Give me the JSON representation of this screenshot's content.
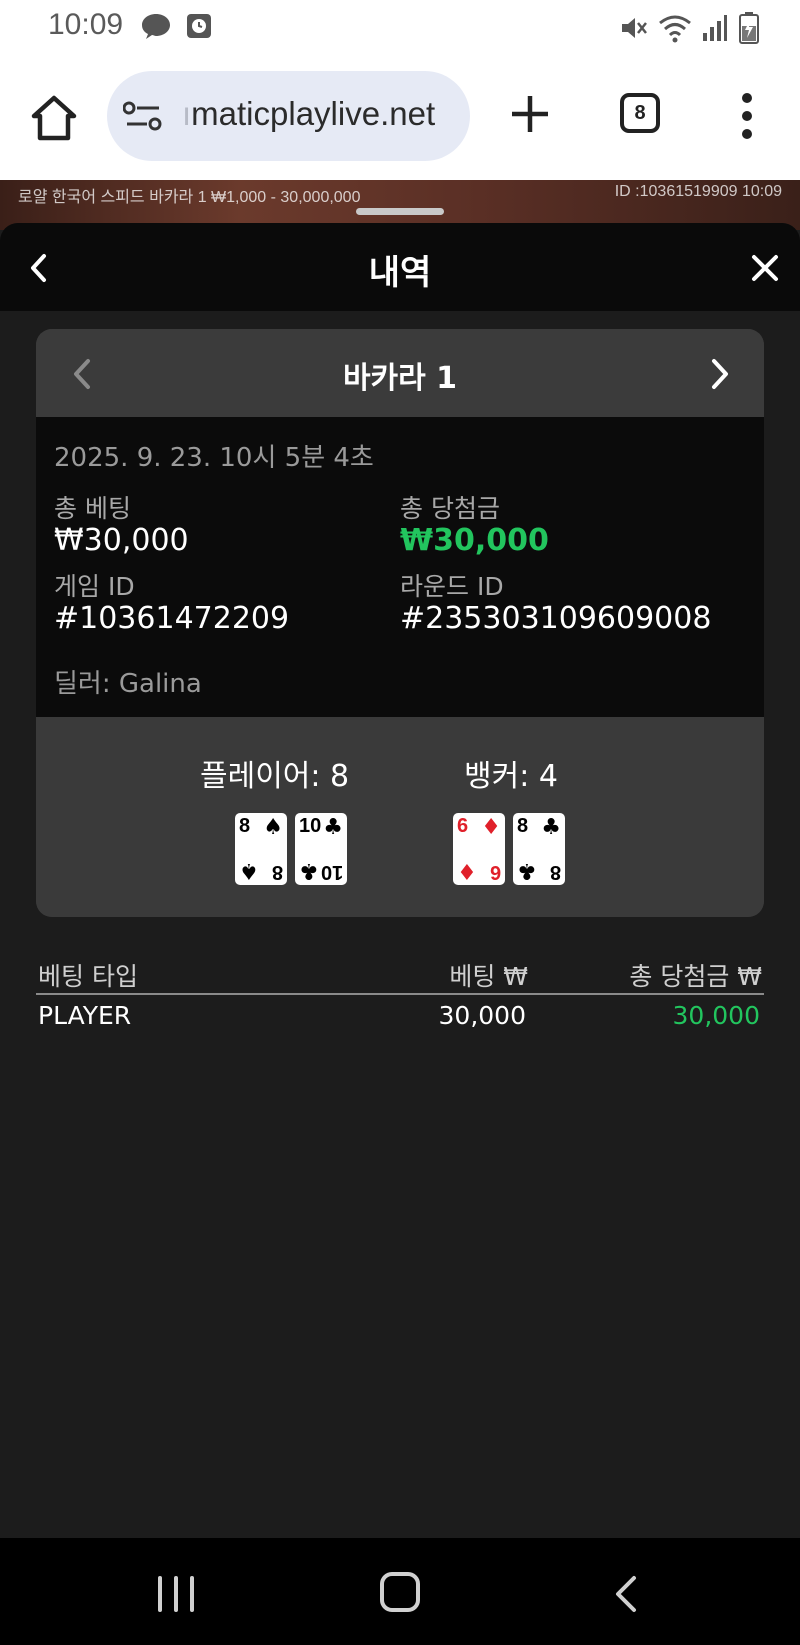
{
  "status_bar": {
    "time": "10:09",
    "left_icons": [
      "chat-bubble-icon",
      "clock-square-icon"
    ],
    "right_icons": [
      "mute-icon",
      "wifi-icon",
      "signal-icon",
      "battery-icon"
    ]
  },
  "browser": {
    "url_prefix": "ı",
    "url": "maticplaylive.net",
    "tab_count": "8"
  },
  "game_strip": {
    "info": "로얄 한국어 스피드 바카라 1 ₩1,000 - 30,000,000",
    "id_time": "ID :10361519909 10:09"
  },
  "sheet": {
    "title": "내역",
    "card": {
      "title": "바카라 1",
      "date": "2025. 9. 23. 10시 5분 4초",
      "total_bet_label": "총 베팅",
      "total_bet_value": "₩30,000",
      "total_win_label": "총 당첨금",
      "total_win_value": "₩30,000",
      "game_id_label": "게임 ID",
      "game_id_value": "#10361472209",
      "round_id_label": "라운드 ID",
      "round_id_value": "#235303109609008",
      "dealer": "딜러: Galina",
      "player_label": "플레이어: 8",
      "banker_label": "뱅커: 4",
      "player_cards": [
        {
          "rank": "8",
          "suit": "♠",
          "color": "black"
        },
        {
          "rank": "10",
          "suit": "♣",
          "color": "black"
        }
      ],
      "banker_cards": [
        {
          "rank": "6",
          "suit": "♦",
          "color": "red"
        },
        {
          "rank": "8",
          "suit": "♣",
          "color": "black"
        }
      ]
    },
    "table": {
      "headers": [
        "베팅 타입",
        "베팅 ₩",
        "총 당첨금 ₩"
      ],
      "rows": [
        {
          "type": "PLAYER",
          "bet": "30,000",
          "win": "30,000"
        }
      ]
    }
  },
  "colors": {
    "win_green": "#22c55e",
    "sheet_bg": "#1c1c1c",
    "info_bg": "#0b0b0b",
    "card_bg": "#3a3a3a"
  }
}
